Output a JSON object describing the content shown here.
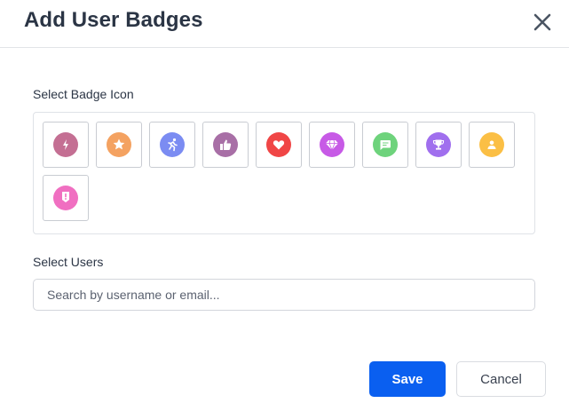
{
  "dialog": {
    "title": "Add User Badges",
    "close_icon": "close-icon"
  },
  "badge_section": {
    "label": "Select Badge Icon",
    "badges": [
      {
        "id": "lightning",
        "icon": "lightning-icon",
        "color": "#c46f93"
      },
      {
        "id": "star",
        "icon": "star-icon",
        "color": "#f4a261"
      },
      {
        "id": "runner",
        "icon": "runner-icon",
        "color": "#7b8cf2"
      },
      {
        "id": "thumbs-up",
        "icon": "thumbs-up-icon",
        "color": "#a86fa6"
      },
      {
        "id": "heart",
        "icon": "heart-icon",
        "color": "#f04646"
      },
      {
        "id": "diamond",
        "icon": "diamond-icon",
        "color": "#c75ae6"
      },
      {
        "id": "chat",
        "icon": "chat-icon",
        "color": "#6ed37c"
      },
      {
        "id": "trophy",
        "icon": "trophy-icon",
        "color": "#a06fee"
      },
      {
        "id": "user",
        "icon": "user-icon",
        "color": "#fbbf45"
      },
      {
        "id": "medal",
        "icon": "medal-icon",
        "color": "#f06fc1"
      }
    ]
  },
  "users_section": {
    "label": "Select Users",
    "search_placeholder": "Search by username or email...",
    "search_value": ""
  },
  "footer": {
    "save_label": "Save",
    "cancel_label": "Cancel",
    "save_color": "#0a5ff0"
  }
}
